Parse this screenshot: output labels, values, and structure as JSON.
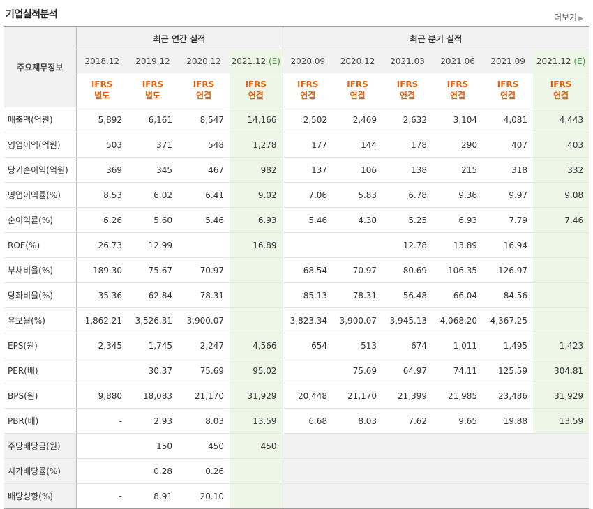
{
  "header": {
    "title": "기업실적분석",
    "more_label": "더보기"
  },
  "table": {
    "row_header": "주요재무정보",
    "group_annual": "최근 연간 실적",
    "group_quarter": "최근 분기 실적",
    "annual_periods": [
      "2018.12",
      "2019.12",
      "2020.12",
      "2021.12"
    ],
    "quarter_periods": [
      "2020.09",
      "2020.12",
      "2021.03",
      "2021.06",
      "2021.09",
      "2021.12"
    ],
    "estimate_mark": "(E)",
    "ifrs_top": "IFRS",
    "ifrs_bottom": [
      "별도",
      "별도",
      "연결",
      "연결",
      "연결",
      "연결",
      "연결",
      "연결",
      "연결",
      "연결"
    ],
    "rows": [
      {
        "label": "매출액(억원)",
        "values": [
          "5,892",
          "6,161",
          "8,547",
          "14,166",
          "2,502",
          "2,469",
          "2,632",
          "3,104",
          "4,081",
          "4,443"
        ]
      },
      {
        "label": "영업이익(억원)",
        "values": [
          "503",
          "371",
          "548",
          "1,278",
          "177",
          "144",
          "178",
          "290",
          "407",
          "403"
        ]
      },
      {
        "label": "당기순이익(억원)",
        "values": [
          "369",
          "345",
          "467",
          "982",
          "137",
          "106",
          "138",
          "215",
          "318",
          "332"
        ]
      },
      {
        "label": "영업이익률(%)",
        "values": [
          "8.53",
          "6.02",
          "6.41",
          "9.02",
          "7.06",
          "5.83",
          "6.78",
          "9.36",
          "9.97",
          "9.08"
        ]
      },
      {
        "label": "순이익률(%)",
        "values": [
          "6.26",
          "5.60",
          "5.46",
          "6.93",
          "5.46",
          "4.30",
          "5.25",
          "6.93",
          "7.79",
          "7.46"
        ]
      },
      {
        "label": "ROE(%)",
        "values": [
          "26.73",
          "12.99",
          "",
          "16.89",
          "",
          "",
          "12.78",
          "13.89",
          "16.94",
          ""
        ]
      },
      {
        "label": "부채비율(%)",
        "values": [
          "189.30",
          "75.67",
          "70.97",
          "",
          "68.54",
          "70.97",
          "80.69",
          "106.35",
          "126.97",
          ""
        ]
      },
      {
        "label": "당좌비율(%)",
        "values": [
          "35.36",
          "62.84",
          "78.31",
          "",
          "85.13",
          "78.31",
          "56.48",
          "66.04",
          "84.56",
          ""
        ]
      },
      {
        "label": "유보율(%)",
        "values": [
          "1,862.21",
          "3,526.31",
          "3,900.07",
          "",
          "3,823.34",
          "3,900.07",
          "3,945.13",
          "4,068.20",
          "4,367.25",
          ""
        ]
      },
      {
        "label": "EPS(원)",
        "values": [
          "2,345",
          "1,745",
          "2,247",
          "4,566",
          "654",
          "513",
          "674",
          "1,011",
          "1,495",
          "1,423"
        ]
      },
      {
        "label": "PER(배)",
        "values": [
          "",
          "30.37",
          "75.69",
          "95.02",
          "",
          "75.69",
          "64.97",
          "74.11",
          "125.59",
          "304.81"
        ]
      },
      {
        "label": "BPS(원)",
        "values": [
          "9,880",
          "18,083",
          "21,170",
          "31,929",
          "20,448",
          "21,170",
          "21,399",
          "21,985",
          "23,486",
          "31,929"
        ]
      },
      {
        "label": "PBR(배)",
        "values": [
          "-",
          "2.93",
          "8.03",
          "13.59",
          "6.68",
          "8.03",
          "7.62",
          "9.65",
          "19.88",
          "13.59"
        ]
      },
      {
        "label": "주당배당금(원)",
        "values": [
          "",
          "150",
          "450",
          "450"
        ]
      },
      {
        "label": "시가배당률(%)",
        "values": [
          "",
          "0.28",
          "0.26",
          ""
        ]
      },
      {
        "label": "배당성향(%)",
        "values": [
          "-",
          "8.91",
          "20.10",
          ""
        ]
      }
    ]
  }
}
